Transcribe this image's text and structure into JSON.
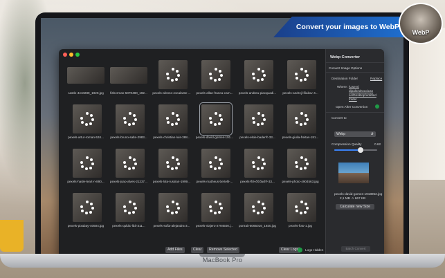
{
  "banner": {
    "text": "Convert your images to WebP"
  },
  "logo": {
    "text": "WebP"
  },
  "laptop": {
    "model": "MacBook Pro"
  },
  "images": [
    {
      "name": "castle-4410289_1920.jpg"
    },
    {
      "name": "fisherman-5070480_192..."
    },
    {
      "name": "pexels-afonso-escalante-..."
    },
    {
      "name": "pexels-allan-franca-carn..."
    },
    {
      "name": "pexels-andrea-piacquadi..."
    },
    {
      "name": "pexels-andrej-líšakov-4..."
    },
    {
      "name": "pexels-artur-roman-534..."
    },
    {
      "name": "pexels-bruno-salte-2983..."
    },
    {
      "name": "pexels-christian-luis-388..."
    },
    {
      "name": "pexels-david-gomes-191..."
    },
    {
      "name": "pexels-elsie-bader®-33..."
    },
    {
      "name": "pexels-giulia-freitas-181..."
    },
    {
      "name": "pexels-hasle-leart-n-890..."
    },
    {
      "name": "pexels-joao-alves-21237..."
    },
    {
      "name": "pexels-lola-russian-1999..."
    },
    {
      "name": "pexels-matheus-bertelli-..."
    },
    {
      "name": "pexels-flð«ð©ð±ð®-33..."
    },
    {
      "name": "pexels-photo-4904563.jpg"
    },
    {
      "name": "pexels-pixabay-40504.jpg"
    },
    {
      "name": "pexels-qukác-lbá-311..."
    },
    {
      "name": "pexels-sofia-alejandra-3..."
    },
    {
      "name": "pexels-viajero-2794500.j..."
    },
    {
      "name": "portrait-5065016_1920.jpg"
    },
    {
      "name": "pexels-foto-1.jpg"
    }
  ],
  "actions": {
    "add_files": "Add Files",
    "clear": "Clear",
    "remove_selected": "Remove Selected"
  },
  "bottom": {
    "clear_logs": "Clear Logs",
    "logs_hidden": "Logs Hidden"
  },
  "panel": {
    "title": "Webp Converter",
    "section": "Convert Image Options",
    "destination_label": "Destination Folder",
    "replace": "Replace",
    "where_label": "Where:",
    "where_path_1": "/Users/",
    "where_path_2": "dipalsedrocoican",
    "where_path_3": "co/Desktop/untitled",
    "where_path_4": "folder",
    "open_after": "Open After Convertion",
    "convert_to_label": "Convert to",
    "convert_to_value": "Webp",
    "quality_label": "Compression Quality",
    "quality_value": "0.62",
    "quality_fraction": 0.62,
    "preview_name": "pexels-david-gomes-1918052.jpg",
    "preview_size": "2,1 MB -> 667 KB",
    "calc_button": "Calculate new Size",
    "batch_button": "Batch Convert"
  },
  "colors": {
    "banner": "#1f6fcf",
    "accent": "#3a82f6",
    "check": "#1f9a46"
  }
}
